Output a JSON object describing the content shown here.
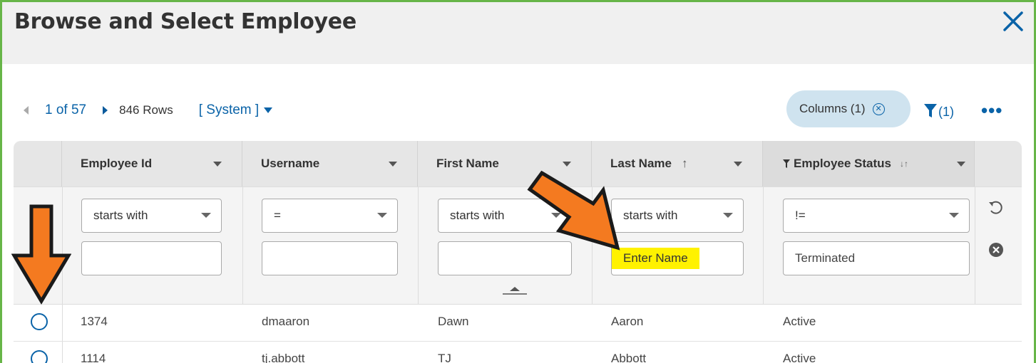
{
  "window": {
    "title": "Browse and Select Employee"
  },
  "toolbar": {
    "page_indicator": "1 of 57",
    "rows_count": "846 Rows",
    "view_selector": "[ System ]",
    "columns_button": "Columns (1)",
    "filter_count": "(1)",
    "more_label": "•••"
  },
  "grid": {
    "columns": [
      {
        "label": "Employee Id",
        "operator": "starts with",
        "value": ""
      },
      {
        "label": "Username",
        "operator": "=",
        "value": ""
      },
      {
        "label": "First Name",
        "operator": "starts with",
        "value": ""
      },
      {
        "label": "Last Name",
        "sort_icon": "↑",
        "operator": "starts with",
        "value": "",
        "placeholder": "Enter Name"
      },
      {
        "label": "Employee Status",
        "sort_icon": "↓↑",
        "operator": "!=",
        "value": "Terminated"
      }
    ],
    "rows": [
      {
        "employee_id": "1374",
        "username": "dmaaron",
        "first_name": "Dawn",
        "last_name": "Aaron",
        "status": "Active"
      },
      {
        "employee_id": "1114",
        "username": "tj.abbott",
        "first_name": "TJ",
        "last_name": "Abbott",
        "status": "Active"
      }
    ]
  },
  "colors": {
    "accent": "#0a63a8",
    "frame_border": "#67b548",
    "highlight": "#fff200",
    "annotation_arrow": "#f47a20"
  }
}
